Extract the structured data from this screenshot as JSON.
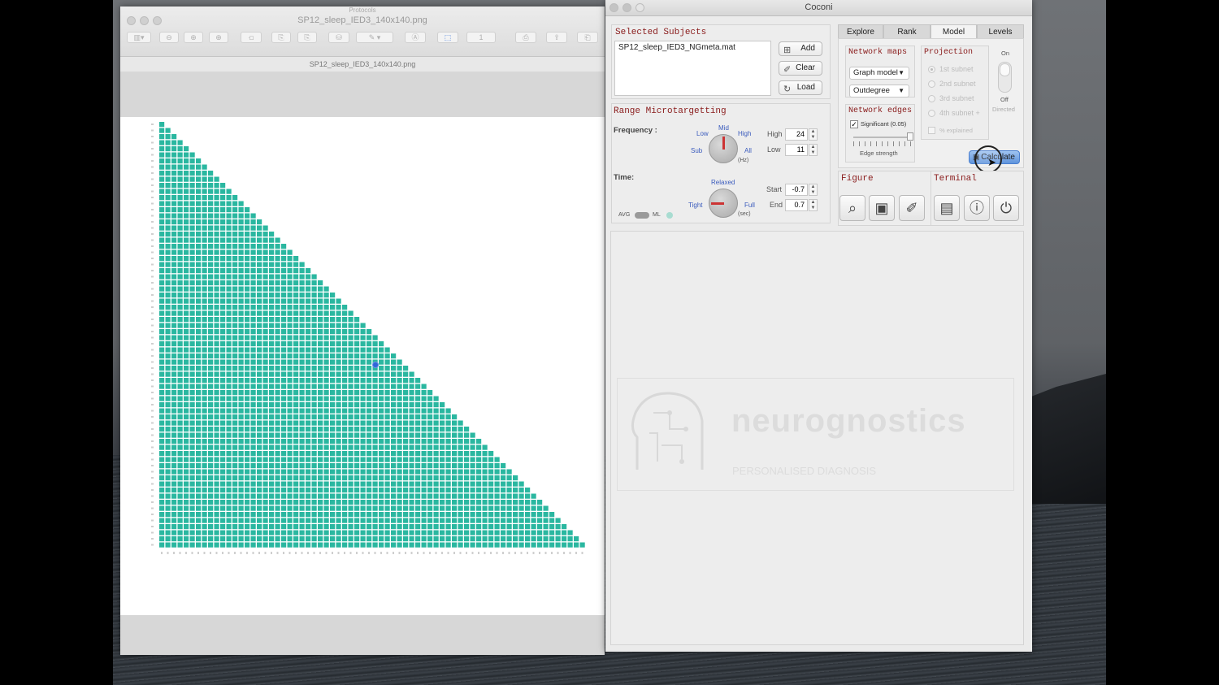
{
  "preview": {
    "folder": "Protocols",
    "title": "SP12_sleep_IED3_140x140.png",
    "subtitle": "SP12_sleep_IED3_140x140.png",
    "page_field": "1",
    "matrix_color": "#2ab7a0"
  },
  "coconi": {
    "title": "Coconi",
    "tabs": [
      "Explore",
      "Rank",
      "Model",
      "Levels"
    ],
    "active_tab": "Model",
    "selected_subjects": {
      "heading": "Selected Subjects",
      "items": [
        "SP12_sleep_IED3_NGmeta.mat"
      ],
      "add": "Add",
      "clear": "Clear",
      "load": "Load"
    },
    "range": {
      "heading": "Range Microtargetting",
      "frequency_label": "Frequency :",
      "freq_knob": {
        "mid": "Mid",
        "low": "Low",
        "high": "High",
        "sub": "Sub",
        "all": "All",
        "unit": "(Hz)"
      },
      "high_label": "High",
      "high_value": "24",
      "low_label": "Low",
      "low_value": "11",
      "time_label": "Time:",
      "time_knob": {
        "relaxed": "Relaxed",
        "tight": "Tight",
        "full": "Full",
        "unit": "(sec)"
      },
      "start_label": "Start",
      "start_value": "-0.7",
      "end_label": "End",
      "end_value": "0.7",
      "avg_label": "AVG",
      "ml_label": "ML"
    },
    "network_maps": {
      "heading": "Network maps",
      "model": "Graph model",
      "measure": "Outdegree"
    },
    "network_edges": {
      "heading": "Network edges",
      "significant": "Significant (0.05)",
      "edge_strength": "Edge strength"
    },
    "projection": {
      "heading": "Projection",
      "options": [
        "1st subnet",
        "2nd subnet",
        "3rd subnet",
        "4th subnet +"
      ],
      "explained": "% explained"
    },
    "toggle": {
      "on": "On",
      "off": "Off",
      "directed": "Directed"
    },
    "calculate": "Calculate",
    "figure": {
      "heading": "Figure"
    },
    "terminal": {
      "heading": "Terminal"
    },
    "logo": {
      "name": "neurognostics",
      "tagline": "PERSONALISED DIAGNOSIS"
    }
  }
}
